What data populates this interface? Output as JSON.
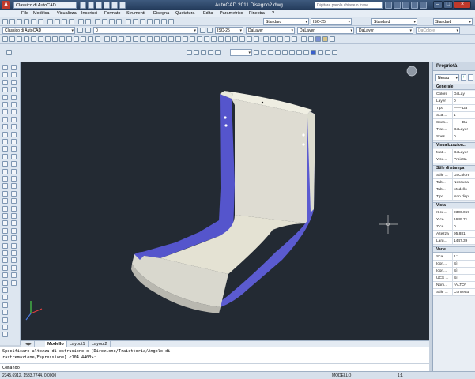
{
  "app": {
    "workspace": "Classico di AutoCAD",
    "title": "AutoCAD 2011    Disegno2.dwg",
    "search_placeholder": "Digitare parola chiave o frase"
  },
  "menu": [
    "File",
    "Modifica",
    "Visualizza",
    "Inserisci",
    "Formato",
    "Strumenti",
    "Disegna",
    "Quotatura",
    "Edita",
    "Parametrico",
    "Finestra",
    "?"
  ],
  "toolbars": {
    "style_text": "Standard",
    "style_dim": "ISO-25",
    "style_table": "Standard",
    "style_mleader": "Standard",
    "workspace2": "Classico di AutoCAD",
    "layer": "0",
    "dimstyle2": "ISO-25",
    "color": "DaLayer",
    "linetype": "DaLayer",
    "lineweight": "DaLayer",
    "plotstyle": "DaColore"
  },
  "tabs": [
    "Modello",
    "Layout1",
    "Layout2"
  ],
  "command": {
    "line1": "Specificare altezza di estrusione o [Direzione/Traiettoria/Angolo di",
    "line2": "rastremazione/Espressione] <104.4403>:",
    "prompt": "Comando:"
  },
  "status": {
    "coords": "2345.6912, 1533.7744, 0.0000",
    "space": "MODELLO",
    "scale": "1:1"
  },
  "properties": {
    "title": "Proprietà",
    "selection": "Nessu",
    "sections": [
      {
        "name": "Generale",
        "rows": [
          [
            "Colore",
            "DaLay"
          ],
          [
            "Layer",
            "0"
          ],
          [
            "Tipo",
            "—— Da"
          ],
          [
            "Scal...",
            "1"
          ],
          [
            "Spes...",
            "—— Da"
          ],
          [
            "Tras...",
            "DaLayer"
          ],
          [
            "Spes...",
            "0"
          ]
        ]
      },
      {
        "name": "Visualizzazion...",
        "rows": [
          [
            "Mat...",
            "DaLayer"
          ],
          [
            "Visu...",
            "Proietta"
          ]
        ]
      },
      {
        "name": "Stile di stampa",
        "rows": [
          [
            "Stile ...",
            "DaColore"
          ],
          [
            "Tab...",
            "Nessuna"
          ],
          [
            "Tab...",
            "Modello"
          ],
          [
            "Tipo ...",
            "Non disp."
          ]
        ]
      },
      {
        "name": "Vista",
        "rows": [
          [
            "X ce...",
            "2306.059"
          ],
          [
            "Y ce...",
            "1649.71"
          ],
          [
            "Z ce...",
            "0"
          ],
          [
            "Altezza",
            "95.881"
          ],
          [
            "Larg...",
            "1447.39"
          ]
        ]
      },
      {
        "name": "Varie",
        "rows": [
          [
            "Scal...",
            "1:1"
          ],
          [
            "Icon...",
            "Sì"
          ],
          [
            "Icon...",
            "Sì"
          ],
          [
            "UCS ...",
            "Sì"
          ],
          [
            "Nom...",
            "*ALTO*"
          ],
          [
            "Stile ...",
            "Concettu"
          ]
        ]
      }
    ]
  },
  "colors": {
    "viewport_bg": "#232a33",
    "solid_side": "#5b5bcf",
    "solid_face": "#e8e6d8"
  }
}
